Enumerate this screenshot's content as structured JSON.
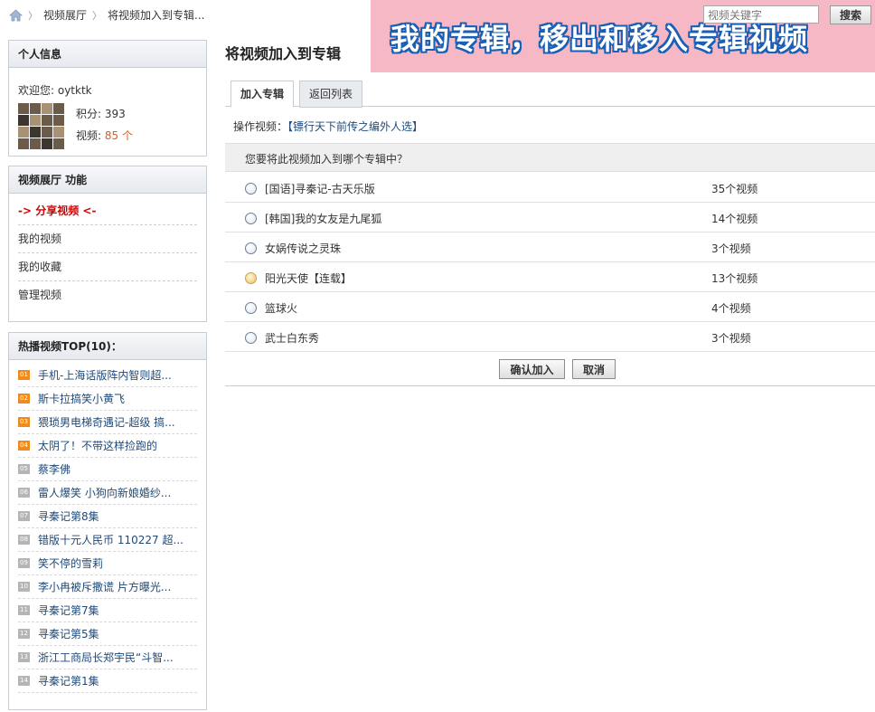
{
  "breadcrumb": {
    "section": "视频展厅",
    "current": "将视频加入到专辑..."
  },
  "banner": {
    "title": "我的专辑，移出和移入专辑视频"
  },
  "search": {
    "placeholder": "视频关键字",
    "button": "搜索"
  },
  "personal": {
    "heading": "个人信息",
    "welcome": "欢迎您: oytktk",
    "points_label": "积分: 393",
    "videos_prefix": "视频: ",
    "videos_value": "85 个"
  },
  "functions": {
    "heading": "视频展厅 功能",
    "items": [
      "-> 分享视频 <-",
      "我的视频",
      "我的收藏",
      "管理视频"
    ]
  },
  "top10": {
    "heading": "热播视频TOP(10)：",
    "items": [
      {
        "rank": "01",
        "title": "手机-上海话版阵内智则超..."
      },
      {
        "rank": "02",
        "title": "斯卡拉搞笑小黄飞"
      },
      {
        "rank": "03",
        "title": "猥琐男电梯奇遇记-超级 搞..."
      },
      {
        "rank": "04",
        "title": "太阴了！不带这样捡跑的"
      },
      {
        "rank": "05",
        "title": "蔡李佛"
      },
      {
        "rank": "06",
        "title": "雷人爆笑 小狗向新娘婚纱..."
      },
      {
        "rank": "07",
        "title": "寻秦记第8集"
      },
      {
        "rank": "08",
        "title": "错版十元人民币 110227 超..."
      },
      {
        "rank": "09",
        "title": "笑不停的雪莉"
      },
      {
        "rank": "10",
        "title": "李小冉被斥撒谎 片方曝光..."
      },
      {
        "rank": "11",
        "title": "寻秦记第7集"
      },
      {
        "rank": "12",
        "title": "寻秦记第5集"
      },
      {
        "rank": "13",
        "title": "浙江工商局长郑宇民“斗智..."
      },
      {
        "rank": "14",
        "title": "寻秦记第1集"
      }
    ]
  },
  "main": {
    "title": "将视频加入到专辑",
    "tabs": [
      "加入专辑",
      "返回列表"
    ],
    "operation_label": "操作视频：",
    "operation_video": "【镖行天下前传之编外人选】",
    "question": "您要将此视频加入到哪个专辑中？",
    "albums": [
      {
        "name": "[国语]寻秦记-古天乐版",
        "count": "35个视频"
      },
      {
        "name": "[韩国]我的女友是九尾狐",
        "count": "14个视频"
      },
      {
        "name": "女娲传说之灵珠",
        "count": "3个视频"
      },
      {
        "name": "阳光天使【连载】",
        "count": "13个视频"
      },
      {
        "name": "篮球火",
        "count": "4个视频"
      },
      {
        "name": "武士白东秀",
        "count": "3个视频"
      }
    ],
    "confirm": "确认加入",
    "cancel": "取消"
  },
  "colors": {
    "accent_link": "#1f4a7a",
    "share_red": "#d40000",
    "orange": "#e05a1e",
    "banner_bg": "#f5b8c4"
  }
}
